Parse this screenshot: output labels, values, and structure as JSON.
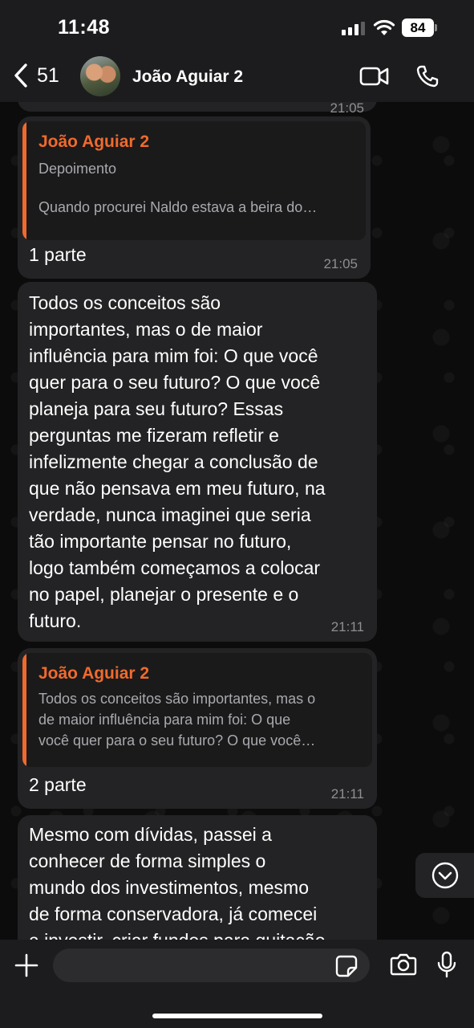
{
  "status_bar": {
    "time": "11:48",
    "battery": "84"
  },
  "header": {
    "back_count": "51",
    "contact_name": "João Aguiar 2"
  },
  "messages": {
    "partial_top_time": "21:05",
    "m1": {
      "quote_author": "João Aguiar 2",
      "quote_line1": "Depoimento",
      "quote_line2": "Quando procurei Naldo estava a beira do…",
      "text": "1 parte",
      "time": "21:05"
    },
    "m2": {
      "lines": [
        "Todos os conceitos são",
        "importantes, mas o de maior",
        "influência para mim foi: O que você",
        "quer para o seu futuro? O que você",
        "planeja para seu futuro? Essas",
        "perguntas me fizeram refletir e",
        "infelizmente chegar a conclusão de",
        "que não pensava em meu futuro, na",
        "verdade, nunca imaginei que seria",
        "tão importante pensar no futuro,",
        "logo também começamos a colocar",
        "no papel, planejar o presente e o",
        "futuro."
      ],
      "time": "21:11"
    },
    "m3": {
      "quote_author": "João Aguiar 2",
      "quote_lines": [
        "Todos os conceitos são importantes, mas o",
        "de maior influência para mim foi: O que",
        "você quer para o seu futuro? O que você…"
      ],
      "text": "2 parte",
      "time": "21:11"
    },
    "m4": {
      "lines": [
        "Mesmo com dívidas, passei a",
        "conhecer de forma simples o",
        "mundo dos investimentos, mesmo",
        "de forma conservadora, já comecei",
        "a investir, criar fundos para quitação"
      ]
    }
  },
  "composer": {
    "placeholder": ""
  },
  "colors": {
    "accent": "#f06a2d",
    "bubble": "#232325",
    "bar": "#1c1c1e"
  }
}
